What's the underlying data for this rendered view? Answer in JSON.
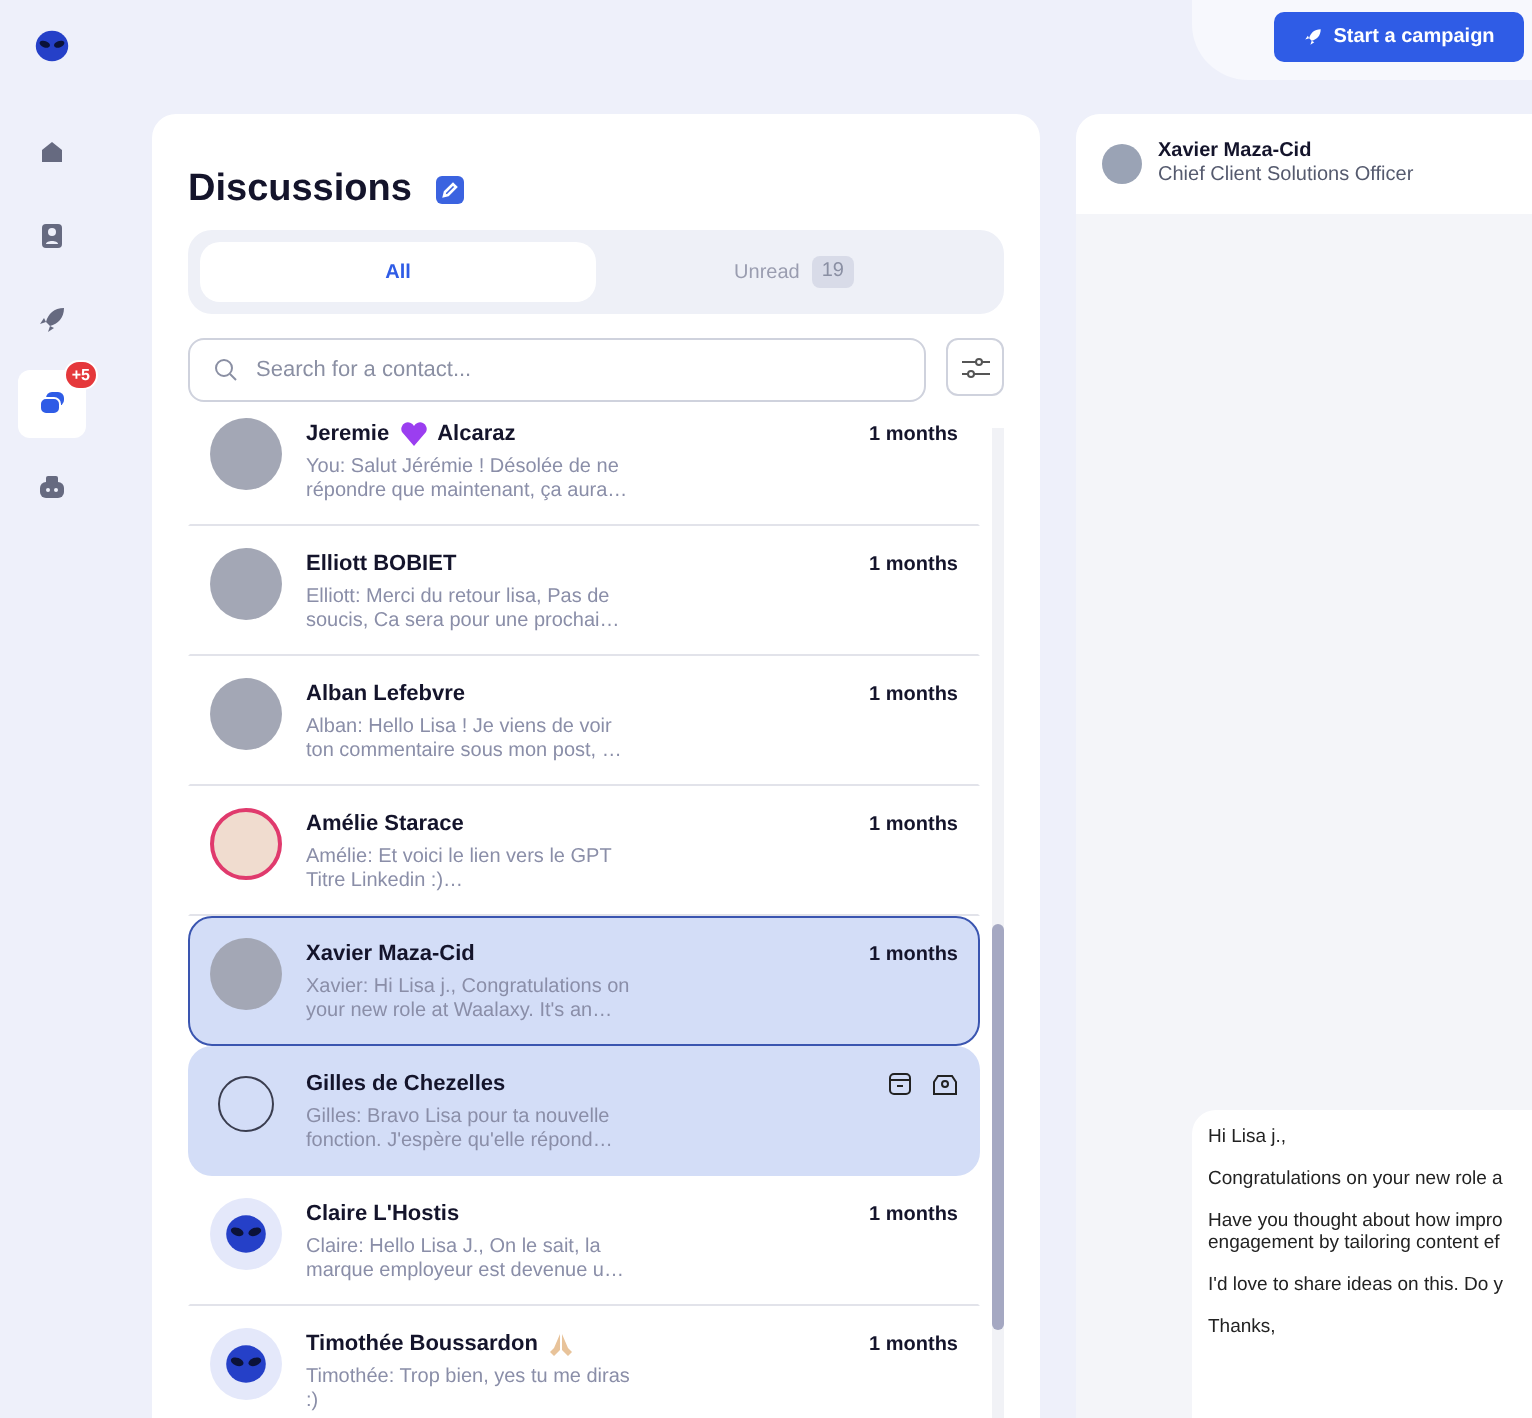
{
  "sidebar": {
    "items": [
      {
        "selected": false
      },
      {
        "selected": false
      },
      {
        "selected": false
      },
      {
        "selected": true,
        "badge": "+5"
      },
      {
        "selected": false
      }
    ]
  },
  "topbar": {
    "button": "Start a campaign"
  },
  "discussions": {
    "title": "Discussions",
    "tabs": [
      {
        "label": "All",
        "selected": true
      },
      {
        "label": "Unread",
        "count": "19",
        "selected": false
      }
    ],
    "search": {
      "placeholder": "Search for a contact..."
    },
    "conversations": [
      {
        "name_parts": [
          {
            "kind": "text",
            "text": "Jeremie"
          },
          {
            "kind": "heart"
          },
          {
            "kind": "text",
            "text": "Alcaraz"
          }
        ],
        "time": "1 months",
        "preview": [
          "You: Salut Jérémie ! Désolée de ne",
          "répondre que maintenant, ça aura…"
        ],
        "kind": "photo",
        "selected": false,
        "hovered": false
      },
      {
        "name_parts": [
          {
            "kind": "text",
            "text": "Elliott BOBIET"
          }
        ],
        "time": "1 months",
        "preview": [
          "Elliott: Merci du retour lisa, Pas de",
          "soucis, Ca sera pour une prochai…"
        ],
        "kind": "photo",
        "selected": false,
        "hovered": false
      },
      {
        "name_parts": [
          {
            "kind": "text",
            "text": "Alban Lefebvre"
          }
        ],
        "time": "1 months",
        "preview": [
          "Alban: Hello Lisa ! Je viens de voir",
          "ton commentaire sous mon post, …"
        ],
        "kind": "photo",
        "selected": false,
        "hovered": false
      },
      {
        "name_parts": [
          {
            "kind": "text",
            "text": "Amélie Starace"
          }
        ],
        "time": "1 months",
        "preview": [
          "Amélie: Et voici le lien vers le GPT",
          "Titre Linkedin :)…"
        ],
        "kind": "ringed",
        "selected": false,
        "hovered": false
      },
      {
        "name_parts": [
          {
            "kind": "text",
            "text": "Xavier Maza-Cid"
          }
        ],
        "time": "1 months",
        "preview": [
          "Xavier: Hi Lisa j., Congratulations on",
          "your new role at Waalaxy. It's an…"
        ],
        "kind": "photo",
        "selected": true,
        "hovered": false
      },
      {
        "name_parts": [
          {
            "kind": "text",
            "text": "Gilles de Chezelles"
          }
        ],
        "preview": [
          "Gilles: Bravo Lisa pour ta nouvelle",
          "fonction. J'espère qu'elle répond…"
        ],
        "kind": "checkbox",
        "checked": false,
        "selected": false,
        "hovered": true
      },
      {
        "name_parts": [
          {
            "kind": "text",
            "text": "Claire L'Hostis"
          }
        ],
        "time": "1 months",
        "preview": [
          "Claire: Hello Lisa J., On le sait, la",
          "marque employeur est devenue u…"
        ],
        "kind": "alien",
        "selected": false,
        "hovered": false
      },
      {
        "name_parts": [
          {
            "kind": "text",
            "text": "Timothée Boussardon"
          },
          {
            "kind": "hands"
          }
        ],
        "time": "1 months",
        "preview": [
          "Timothée: Trop bien, yes tu me diras",
          ":)"
        ],
        "kind": "alien",
        "selected": false,
        "hovered": false
      }
    ]
  },
  "chat": {
    "contact": {
      "name": "Xavier Maza-Cid",
      "title": "Chief Client Solutions Officer"
    },
    "message": {
      "paragraphs": [
        [
          "Hi Lisa j.,"
        ],
        [
          "Congratulations on your new role a"
        ],
        [
          "Have you thought about how impro",
          "engagement by tailoring content ef"
        ],
        [
          "I'd love to share ideas on this. Do y"
        ],
        [
          "Thanks,"
        ]
      ]
    }
  }
}
